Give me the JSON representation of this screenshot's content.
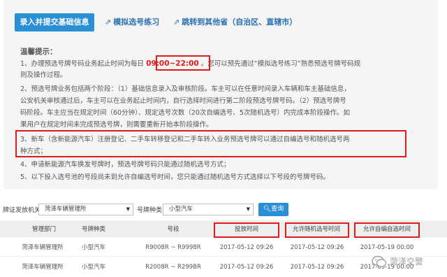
{
  "top_buttons": {
    "submit_label": "录入并提交基础信息",
    "simulate_label": "模拟选号练习",
    "jump_label": "跳转到其他省（自治区、直辖市）"
  },
  "tips": {
    "title": "温馨提示：",
    "line1_a": "1、办理预选号牌号码业务起止时间为每日",
    "hours": "09:00~22:00",
    "line1_b": "。您可以预先通过“模拟选号练习”熟悉预选号牌号码规",
    "line1_c": "则及操作过程。",
    "line2_a": "2、预选号牌业务包括两个阶段：（1）基础信息录入及审核阶段。车主可以在任意时间录入车辆和车主基础信息，",
    "line2_b": "公安机关审核通过后，车主可以在业务起止时间内，自行选择时间进行第二阶段预选号牌号码。（2）预选号牌号",
    "line2_c": "码阶段。车主应当在规定时间（60分钟）、规定选号次数（20次自编选号、5次随机选号）内完成本阶段操作。如",
    "line2_d": "果用户在规定时间未完成预选号牌，则需要重新开始本阶段操作。",
    "line3_a": "3、新车（含新能源汽车）注册登记、二手车转移登记和二手车转入业务预选号牌可以通过自编选号和随机选号两",
    "line3_b": "种方式；",
    "line4": "4、申请新能源汽车换发号牌时，预选号牌号码只能通过随机选号方式；",
    "line5": "5、以下投入选号池的号段尚未到允许自编选号时间，您只能通过随机选号方式选择以下号段的号牌号码。"
  },
  "filters": {
    "org_label": "牌证发放机关",
    "org_value": "菏泽车辆管理所",
    "type_label": "号牌种类",
    "type_value": "小型汽车",
    "query_label": "查询"
  },
  "table": {
    "headers": [
      "管理部门",
      "号牌种类",
      "号段",
      "投放时间",
      "允许随机选号时间",
      "允许自编自选时间"
    ],
    "rows": [
      [
        "菏泽车辆管理所",
        "小型汽车",
        "R9008R ~ R9998R",
        "2017-05-12 09:26",
        "2017-05-12 09:26",
        "2017-05-19 00:00"
      ],
      [
        "菏泽车辆管理所",
        "小型汽车",
        "R2008R ~ R299BR",
        "2017-05-12 09:26",
        "2017-05-12 09:26",
        "2017-05-19 00:00"
      ]
    ]
  },
  "watermark": {
    "text": "菏泽交警"
  },
  "accent": "#2b8fd6",
  "highlight": "#e01b1b"
}
